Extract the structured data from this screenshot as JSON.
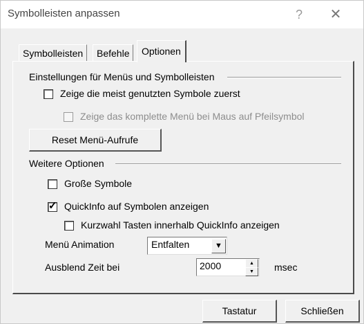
{
  "window": {
    "title": "Symbolleisten anpassen",
    "help_symbol": "?",
    "close_symbol": "✕"
  },
  "tabs": [
    {
      "label": "Symbolleisten",
      "active": false
    },
    {
      "label": "Befehle",
      "active": false
    },
    {
      "label": "Optionen",
      "active": true
    }
  ],
  "menus_group": {
    "title": "Einstellungen für Menüs und Symbolleisten",
    "show_recent": {
      "label": "Zeige die meist genutzten Symbole zuerst",
      "checked": false,
      "enabled": true
    },
    "show_full_menu": {
      "label": "Zeige das komplette Menü bei Maus auf Pfeilsymbol",
      "checked": false,
      "enabled": false
    },
    "reset_button": "Reset Menü-Aufrufe"
  },
  "other_group": {
    "title": "Weitere Optionen",
    "large_icons": {
      "label": "Große Symbole",
      "checked": false
    },
    "tooltips": {
      "label": "QuickInfo auf Symbolen anzeigen",
      "checked": true
    },
    "shortcut_keys": {
      "label": "Kurzwahl Tasten innerhalb QuickInfo anzeigen",
      "checked": false
    },
    "menu_animation": {
      "label": "Menü Animation",
      "value": "Entfalten"
    },
    "fade_time": {
      "label": "Ausblend Zeit bei",
      "value": "2000",
      "unit": "msec"
    }
  },
  "footer": {
    "keyboard_button": "Tastatur",
    "close_button": "Schließen"
  }
}
